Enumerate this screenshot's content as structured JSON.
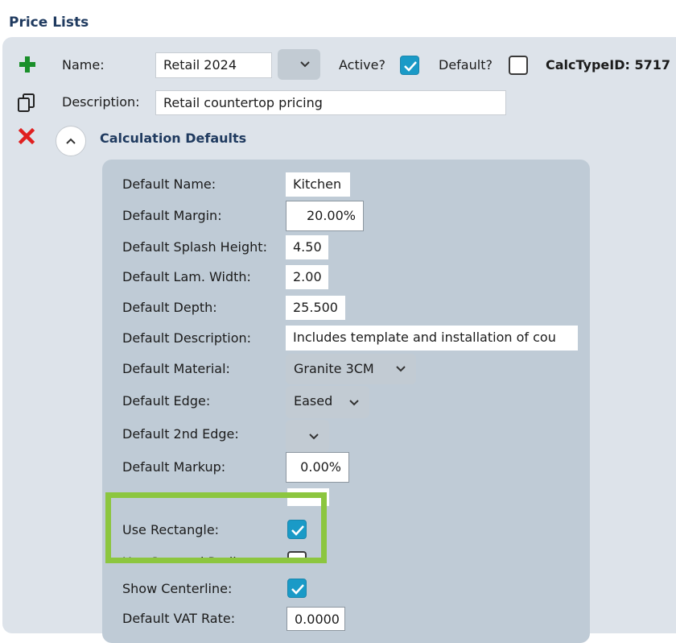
{
  "page": {
    "title": "Price Lists"
  },
  "header": {
    "name_label": "Name:",
    "name_value": "Retail 2024",
    "active_label": "Active?",
    "active_checked": true,
    "default_label": "Default?",
    "default_checked": false,
    "calc_type": "CalcTypeID: 5717",
    "description_label": "Description:",
    "description_value": "Retail countertop pricing",
    "section_title": "Calculation Defaults"
  },
  "icons": {
    "add": "plus-icon",
    "copy": "copy-icon",
    "delete": "close-icon",
    "collapse": "chevron-up-icon",
    "dropdown": "chevron-down-icon",
    "check": "checkmark-icon"
  },
  "colors": {
    "title": "#1f3a5f",
    "add_icon": "#1a8f2a",
    "delete_icon": "#e02020",
    "checkbox": "#1a9ac7",
    "highlight": "#8cc63f",
    "panel": "#dde3ea",
    "inner_panel": "#bfcbd6"
  },
  "defaults": {
    "name_label": "Default Name:",
    "name_value": "Kitchen",
    "margin_label": "Default Margin:",
    "margin_value": "20.00%",
    "splash_label": "Default Splash Height:",
    "splash_value": "4.50",
    "lam_label": "Default Lam. Width:",
    "lam_value": "2.00",
    "depth_label": "Default Depth:",
    "depth_value": "25.500",
    "desc_label": "Default Description:",
    "desc_value": "Includes template and installation of cou",
    "material_label": "Default Material:",
    "material_value": "Granite 3CM",
    "edge_label": "Default Edge:",
    "edge_value": "Eased",
    "edge2_label": "Default 2nd Edge:",
    "edge2_value": "",
    "markup_label": "Default Markup:",
    "markup_value": "0.00%",
    "use_rectangle_label": "Use Rectangle:",
    "use_rectangle_checked": true,
    "use_squared_label": "Use Squared Radius:",
    "use_squared_checked": false,
    "centerline_label": "Show Centerline:",
    "centerline_checked": true,
    "vat_label": "Default VAT Rate:",
    "vat_value": "0.0000"
  }
}
